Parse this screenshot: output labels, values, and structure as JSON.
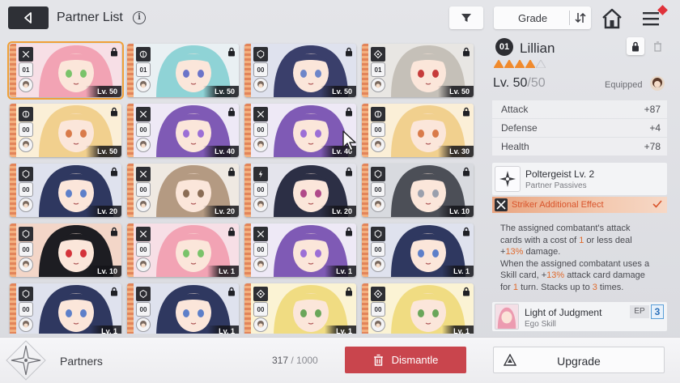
{
  "header": {
    "title": "Partner List",
    "info_glyph": "i",
    "sort_label": "Grade",
    "icons": [
      "back-icon",
      "info-icon",
      "filter-icon",
      "sort-order-icon",
      "home-icon",
      "menu-icon"
    ]
  },
  "cards": [
    {
      "grade": "01",
      "level": "Lv. 50",
      "cls": "striker",
      "hair": "#f2a3b4",
      "bg": "#f7dfe6",
      "eye": "#7ac36a",
      "selected": true
    },
    {
      "grade": "01",
      "level": "Lv. 50",
      "cls": "vanguard",
      "hair": "#8fd3d6",
      "bg": "#e9f0f3",
      "eye": "#6b74c9",
      "selected": false
    },
    {
      "grade": "00",
      "level": "Lv. 50",
      "cls": "ranger",
      "hair": "#3a3f6b",
      "bg": "#dfe2ee",
      "eye": "#6e86c9",
      "selected": false
    },
    {
      "grade": "01",
      "level": "Lv. 50",
      "cls": "hunter",
      "hair": "#c5c0b8",
      "bg": "#e8e6e3",
      "eye": "#c63b3b",
      "selected": false
    },
    {
      "grade": "00",
      "level": "Lv. 50",
      "cls": "vanguard",
      "hair": "#f1d08e",
      "bg": "#fbefd7",
      "eye": "#d97b4a",
      "selected": false
    },
    {
      "grade": "00",
      "level": "Lv. 40",
      "cls": "striker",
      "hair": "#7f5ab5",
      "bg": "#eee9f6",
      "eye": "#9c6fd6",
      "selected": false
    },
    {
      "grade": "00",
      "level": "Lv. 40",
      "cls": "striker",
      "hair": "#7f5ab5",
      "bg": "#eee9f6",
      "eye": "#9c6fd6",
      "selected": false
    },
    {
      "grade": "00",
      "level": "Lv. 30",
      "cls": "vanguard",
      "hair": "#f1d08e",
      "bg": "#fbefd7",
      "eye": "#d97b4a",
      "selected": false
    },
    {
      "grade": "00",
      "level": "Lv. 20",
      "cls": "ranger",
      "hair": "#2f3860",
      "bg": "#dfe2ee",
      "eye": "#5d7fc9",
      "selected": false
    },
    {
      "grade": "00",
      "level": "Lv. 20",
      "cls": "striker",
      "hair": "#b49a82",
      "bg": "#efe9e2",
      "eye": "#8b6d55",
      "selected": false
    },
    {
      "grade": "00",
      "level": "Lv. 20",
      "cls": "controller",
      "hair": "#2c2f45",
      "bg": "#e4e4ec",
      "eye": "#b04a8a",
      "selected": false
    },
    {
      "grade": "00",
      "level": "Lv. 10",
      "cls": "ranger",
      "hair": "#4c4f57",
      "bg": "#d8dadf",
      "eye": "#9aa0ad",
      "selected": false
    },
    {
      "grade": "00",
      "level": "Lv. 10",
      "cls": "ranger",
      "hair": "#1d1d22",
      "bg": "#f3d6c8",
      "eye": "#d4333a",
      "selected": false
    },
    {
      "grade": "00",
      "level": "Lv. 1",
      "cls": "striker",
      "hair": "#f2a3b4",
      "bg": "#f7dfe6",
      "eye": "#7ac36a",
      "selected": false
    },
    {
      "grade": "00",
      "level": "Lv. 1",
      "cls": "striker",
      "hair": "#7f5ab5",
      "bg": "#eee9f6",
      "eye": "#9c6fd6",
      "selected": false
    },
    {
      "grade": "00",
      "level": "Lv. 1",
      "cls": "ranger",
      "hair": "#2f3860",
      "bg": "#dfe2ee",
      "eye": "#5d7fc9",
      "selected": false
    },
    {
      "grade": "00",
      "level": "Lv. 1",
      "cls": "ranger",
      "hair": "#2f3860",
      "bg": "#dfe2ee",
      "eye": "#5d7fc9",
      "selected": false
    },
    {
      "grade": "00",
      "level": "Lv. 1",
      "cls": "ranger",
      "hair": "#2f3860",
      "bg": "#dfe2ee",
      "eye": "#5d7fc9",
      "selected": false
    },
    {
      "grade": "00",
      "level": "Lv. 1",
      "cls": "hunter",
      "hair": "#f0dc82",
      "bg": "#fbf3d4",
      "eye": "#6aa65a",
      "selected": false
    },
    {
      "grade": "00",
      "level": "Lv. 1",
      "cls": "hunter",
      "hair": "#f0dc82",
      "bg": "#fbf3d4",
      "eye": "#6aa65a",
      "selected": false
    }
  ],
  "detail": {
    "grade": "01",
    "name": "Lillian",
    "stars_filled": 4,
    "stars_total": 5,
    "level": "Lv. 50",
    "level_cap": "/50",
    "equipped_label": "Equipped",
    "stats": [
      {
        "label": "Attack",
        "value": "+87"
      },
      {
        "label": "Defense",
        "value": "+4"
      },
      {
        "label": "Health",
        "value": "+78"
      }
    ],
    "passive": {
      "name": "Poltergeist Lv. 2",
      "type": "Partner Passives"
    },
    "effect_label": "Striker Additional Effect",
    "description": {
      "l1": "The assigned combatant's attack",
      "l2a": "cards with a cost of ",
      "l2b": "1",
      "l2c": " or less deal",
      "l3a": "+",
      "l3b": "13%",
      "l3c": " damage.",
      "l4": "When the assigned combatant uses a",
      "l5a": "Skill card, +",
      "l5b": "13%",
      "l5c": " attack card damage",
      "l6a": "for ",
      "l6b": "1",
      "l6c": " turn. Stacks up to ",
      "l6d": "3",
      "l6e": " times."
    },
    "ego": {
      "name": "Light of Judgment",
      "type": "Ego Skill",
      "ep_label": "EP",
      "ep_value": "3"
    }
  },
  "bottom": {
    "title": "Partners",
    "count": "317",
    "capacity": " / 1000",
    "dismantle_label": "Dismantle",
    "upgrade_label": "Upgrade"
  },
  "colors": {
    "accent_orange": "#e06a2c",
    "dismantle_red": "#c9454d",
    "selected_outline": "#f0a038"
  }
}
